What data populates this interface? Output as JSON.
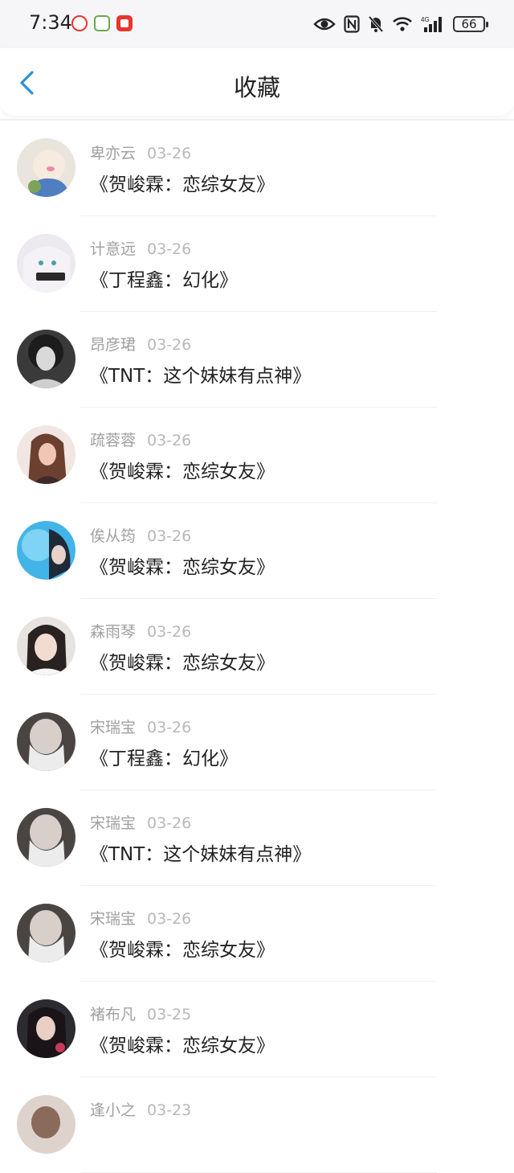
{
  "status_bar": {
    "time": "7:34",
    "battery": "66",
    "network": "4G"
  },
  "header": {
    "title": "收藏"
  },
  "items": [
    {
      "user": "卑亦云",
      "date": "03-26",
      "text": "《贺峻霖：恋综女友》"
    },
    {
      "user": "计意远",
      "date": "03-26",
      "text": "《丁程鑫：幻化》"
    },
    {
      "user": "昂彦珺",
      "date": "03-26",
      "text": "《TNT：这个妹妹有点神》"
    },
    {
      "user": "疏蓉蓉",
      "date": "03-26",
      "text": "《贺峻霖：恋综女友》"
    },
    {
      "user": "俟从筠",
      "date": "03-26",
      "text": "《贺峻霖：恋综女友》"
    },
    {
      "user": "森雨琴",
      "date": "03-26",
      "text": "《贺峻霖：恋综女友》"
    },
    {
      "user": "宋瑞宝",
      "date": "03-26",
      "text": "《丁程鑫：幻化》"
    },
    {
      "user": "宋瑞宝",
      "date": "03-26",
      "text": "《TNT：这个妹妹有点神》"
    },
    {
      "user": "宋瑞宝",
      "date": "03-26",
      "text": "《贺峻霖：恋综女友》"
    },
    {
      "user": "褚布凡",
      "date": "03-25",
      "text": "《贺峻霖：恋综女友》"
    },
    {
      "user": "逢小之",
      "date": "03-23",
      "text": ""
    }
  ]
}
